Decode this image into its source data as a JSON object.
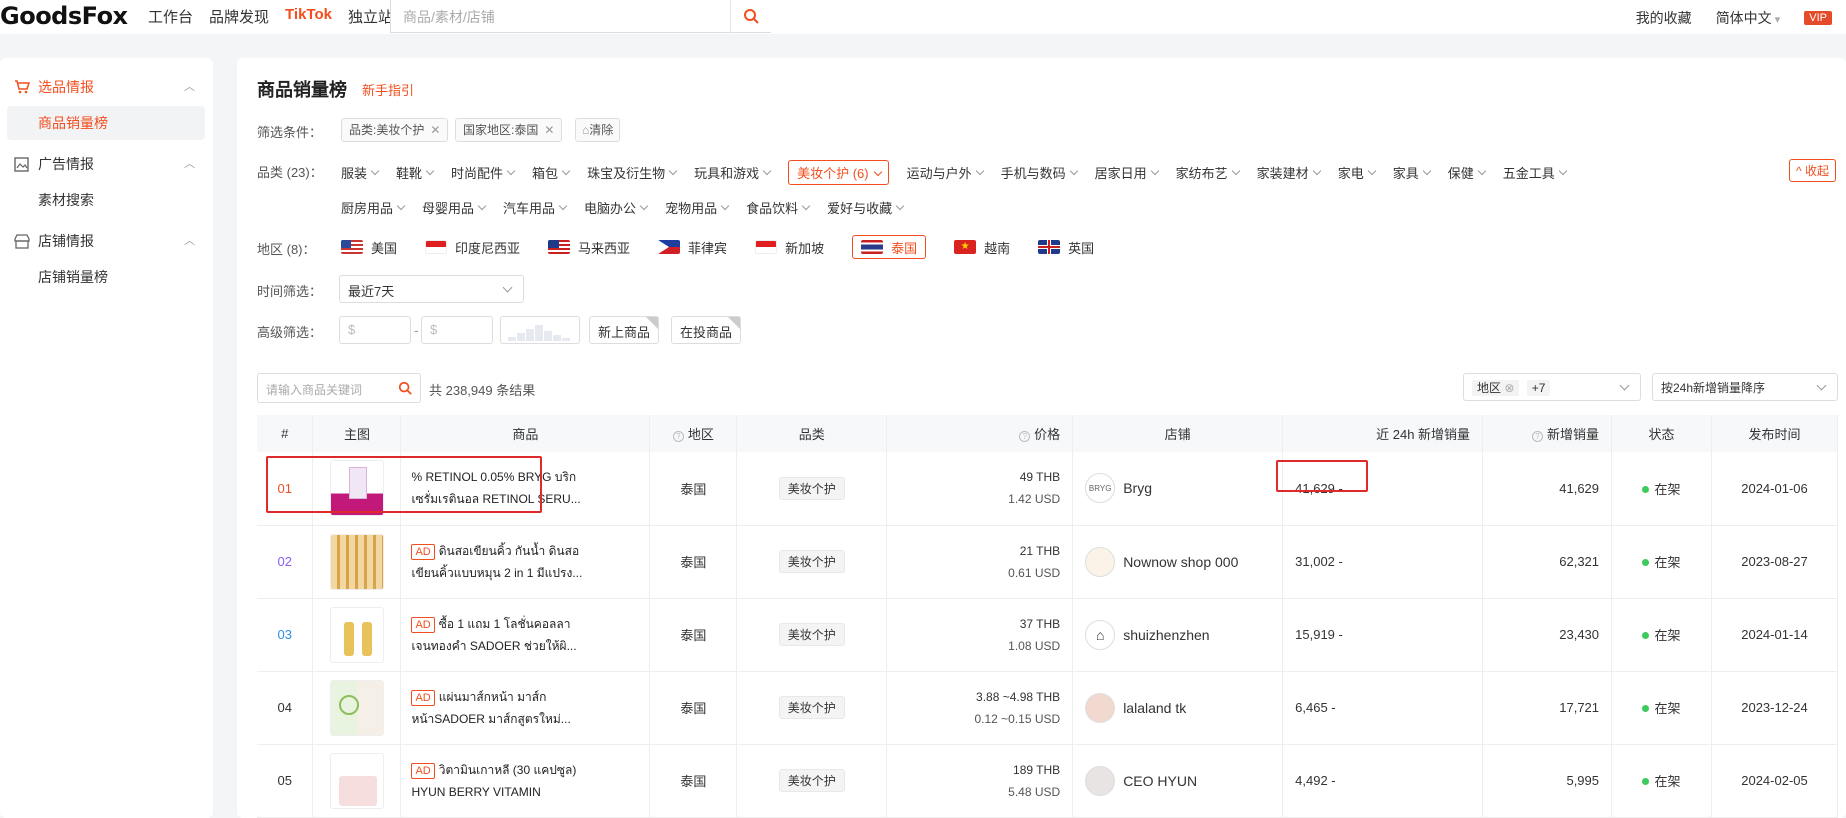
{
  "topbar": {
    "logo": "GoodsFox",
    "nav": [
      "工作台",
      "品牌发现",
      "TikTok",
      "独立站"
    ],
    "search_placeholder": "商品/素材/店铺",
    "favorites": "我的收藏",
    "language": "简体中文",
    "vip": "VIP"
  },
  "sidebar": {
    "groups": [
      {
        "label": "选品情报",
        "items": [
          "商品销量榜"
        ]
      },
      {
        "label": "广告情报",
        "items": [
          "素材搜索"
        ]
      },
      {
        "label": "店铺情报",
        "items": [
          "店铺销量榜"
        ]
      }
    ]
  },
  "page": {
    "title": "商品销量榜",
    "guide": "新手指引"
  },
  "filters": {
    "conditions_label": "筛选条件：",
    "chips": [
      "品类:美妆个护",
      "国家地区:泰国"
    ],
    "clear": "清除",
    "category_label": "品类 (23)：",
    "categories_row1": [
      "服装",
      "鞋靴",
      "时尚配件",
      "箱包",
      "珠宝及衍生物",
      "玩具和游戏",
      "美妆个护 (6)",
      "运动与户外",
      "手机与数码",
      "居家日用",
      "家纺布艺",
      "家装建材",
      "家电",
      "家具",
      "保健",
      "五金工具"
    ],
    "categories_row2": [
      "厨房用品",
      "母婴用品",
      "汽车用品",
      "电脑办公",
      "宠物用品",
      "食品饮料",
      "爱好与收藏"
    ],
    "collapse": "收起",
    "region_label": "地区 (8)：",
    "regions": [
      "美国",
      "印度尼西亚",
      "马来西亚",
      "菲律宾",
      "新加坡",
      "泰国",
      "越南",
      "英国"
    ],
    "time_label": "时间筛选：",
    "time_value": "最近7天",
    "advanced_label": "高级筛选：",
    "price_min_placeholder": "$",
    "price_max_placeholder": "$",
    "toggle_new": "新上商品",
    "toggle_ad": "在投商品"
  },
  "results": {
    "keyword_placeholder": "请输入商品关键词",
    "total": "共 238,949 条结果",
    "region_filter_label": "地区",
    "region_filter_more": "+7",
    "sort_value": "按24h新增销量降序"
  },
  "table": {
    "headers": [
      "#",
      "主图",
      "商品",
      "地区",
      "品类",
      "价格",
      "店铺",
      "近 24h 新增销量",
      "新增销量",
      "状态",
      "发布时间"
    ],
    "rows": [
      {
        "rank": "01",
        "ad": "",
        "name": "% RETINOL 0.05% BRYG บริก เซรั่มเรตินอล RETINOL SERU...",
        "region": "泰国",
        "category": "美妆个护",
        "price": "49 THB",
        "usd": "1.42 USD",
        "shop": "Bryg",
        "avatar": "BRYG",
        "h24": "41,629 -",
        "sales": "41,629",
        "status": "在架",
        "date": "2024-01-06"
      },
      {
        "rank": "02",
        "ad": "AD",
        "name": "ดินสอเขียนคิ้ว กันน้ำ ดินสอเขียนคิ้วแบบหมุน 2 in 1 มีแปรง...",
        "region": "泰国",
        "category": "美妆个护",
        "price": "21 THB",
        "usd": "0.61 USD",
        "shop": "Nownow shop 000",
        "avatar": "",
        "h24": "31,002 -",
        "sales": "62,321",
        "status": "在架",
        "date": "2023-08-27"
      },
      {
        "rank": "03",
        "ad": "AD",
        "name": "ซื้อ 1 แถม 1 โลชั่นคอลลาเจนทองคำ SADOER ช่วยให้ผิ...",
        "region": "泰国",
        "category": "美妆个护",
        "price": "37 THB",
        "usd": "1.08 USD",
        "shop": "shuizhenzhen",
        "avatar": "",
        "h24": "15,919 -",
        "sales": "23,430",
        "status": "在架",
        "date": "2024-01-14"
      },
      {
        "rank": "04",
        "ad": "AD",
        "name": "แผ่นมาส์กหน้า มาส์กหน้าSADOER มาส์กสูตรใหม่...",
        "region": "泰国",
        "category": "美妆个护",
        "price": "3.88 ~4.98 THB",
        "usd": "0.12 ~0.15 USD",
        "shop": "lalaland tk",
        "avatar": "",
        "h24": "6,465 -",
        "sales": "17,721",
        "status": "在架",
        "date": "2023-12-24"
      },
      {
        "rank": "05",
        "ad": "AD",
        "name": "วิตามินเกาหลี (30 แคปซูล) HYUN BERRY VITAMIN",
        "region": "泰国",
        "category": "美妆个护",
        "price": "189 THB",
        "usd": "5.48 USD",
        "shop": "CEO HYUN",
        "avatar": "",
        "h24": "4,492 -",
        "sales": "5,995",
        "status": "在架",
        "date": "2024-02-05"
      }
    ]
  },
  "colors": {
    "accent": "#f24e1e",
    "highlight": "#e02a2a",
    "status_ok": "#3dc95b"
  }
}
